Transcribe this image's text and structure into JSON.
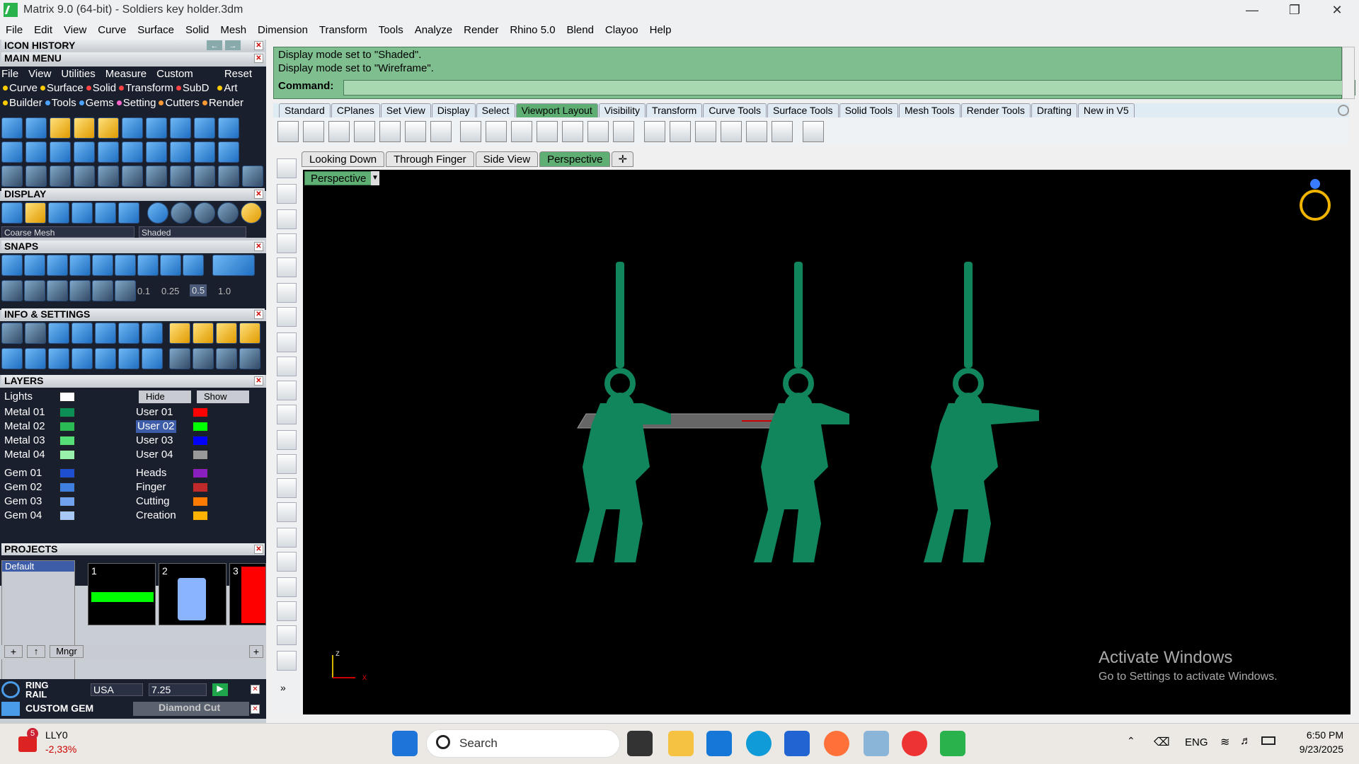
{
  "window": {
    "title": "Matrix 9.0 (64-bit) - Soldiers key holder.3dm"
  },
  "menubar": [
    "File",
    "Edit",
    "View",
    "Curve",
    "Surface",
    "Solid",
    "Mesh",
    "Dimension",
    "Transform",
    "Tools",
    "Analyze",
    "Render",
    "Rhino 5.0",
    "Blend",
    "Clayoo",
    "Help"
  ],
  "left": {
    "icon_history": "ICON HISTORY",
    "main_menu": "MAIN MENU",
    "mm_row1": [
      "File",
      "View",
      "Utilities",
      "Measure",
      "Custom",
      "Reset"
    ],
    "mm_row2": [
      "Curve",
      "Surface",
      "Solid",
      "Transform",
      "SubD",
      "Art"
    ],
    "mm_row3": [
      "Builder",
      "Tools",
      "Gems",
      "Setting",
      "Cutters",
      "Render"
    ],
    "display": "DISPLAY",
    "display_mesh": "Coarse Mesh",
    "display_mode": "Shaded",
    "snaps": "SNAPS",
    "snap_values": [
      "0.1",
      "0.25",
      "0.5",
      "1.0"
    ],
    "info": "INFO & SETTINGS",
    "layers": "LAYERS",
    "lights": "Lights",
    "hide": "Hide",
    "show": "Show",
    "layers_left": [
      "Metal 01",
      "Metal 02",
      "Metal 03",
      "Metal 04",
      "Gem 01",
      "Gem 02",
      "Gem 03",
      "Gem 04"
    ],
    "layers_right": [
      "User 01",
      "User 02",
      "User 03",
      "User 04",
      "Heads",
      "Finger",
      "Cutting",
      "Creation"
    ],
    "projects": "PROJECTS",
    "project_default": "Default",
    "project_nums": [
      "1",
      "2",
      "3"
    ],
    "mngr": "Mngr",
    "ring_rail": "RING\nRAIL",
    "ring_std": "USA",
    "ring_size": "7.25",
    "custom_gem": "CUSTOM GEM",
    "custom_gem_value": "Diamond Cut"
  },
  "command": {
    "line1": "Display mode set to \"Shaded\".",
    "line2": "Display mode set to \"Wireframe\".",
    "prompt": "Command:"
  },
  "tabs": [
    "Standard",
    "CPlanes",
    "Set View",
    "Display",
    "Select",
    "Viewport Layout",
    "Visibility",
    "Transform",
    "Curve Tools",
    "Surface Tools",
    "Solid Tools",
    "Mesh Tools",
    "Render Tools",
    "Drafting",
    "New in V5"
  ],
  "active_tab": "Viewport Layout",
  "viewtabs": [
    "Looking Down",
    "Through Finger",
    "Side View",
    "Perspective"
  ],
  "active_viewtab": "Perspective",
  "viewport_name": "Perspective",
  "axis": {
    "z": "z",
    "x": "x"
  },
  "activate": {
    "title": "Activate Windows",
    "sub": "Go to Settings to activate Windows."
  },
  "taskbar": {
    "stock": "LLY0",
    "stock_change": "-2,33%",
    "stock_badge": "5",
    "search": "Search",
    "lang": "ENG",
    "time": "6:50 PM",
    "date": "9/23/2025"
  },
  "colors": {
    "model": "#11865c",
    "accent": "#5fae73"
  }
}
